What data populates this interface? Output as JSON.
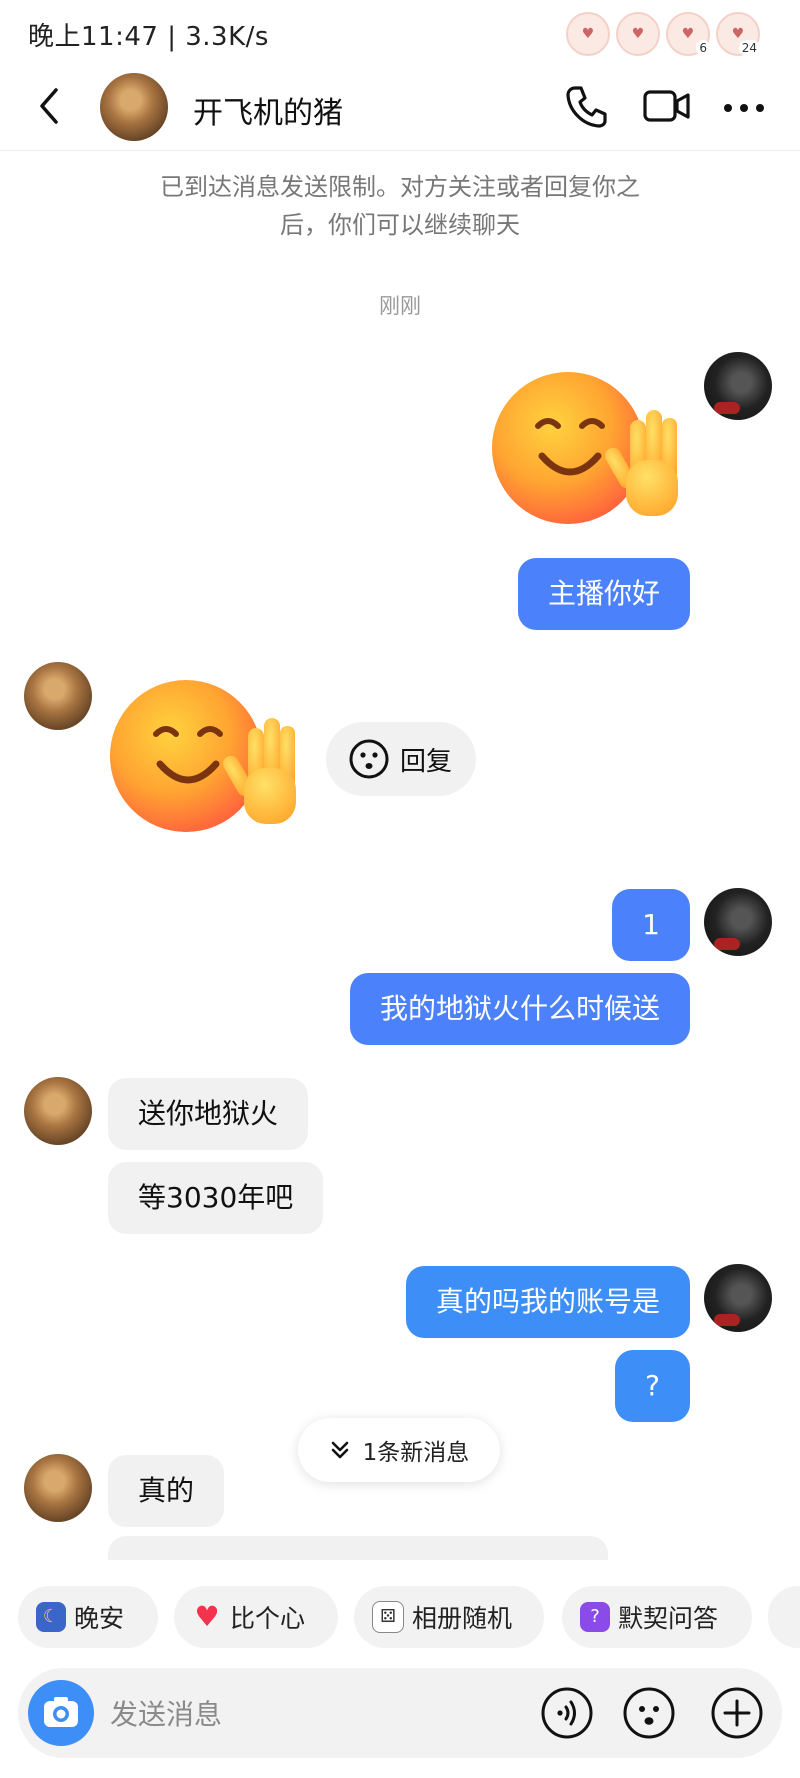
{
  "status_bar": {
    "time": "晚上11:47 | 3.3K/s",
    "badge_1": "6",
    "badge_2": "24"
  },
  "header": {
    "contact_name": "开飞机的猪"
  },
  "notice": {
    "text": "已到达消息发送限制。对方关注或者回复你之后，你们可以继续聊天"
  },
  "time_divider": "刚刚",
  "messages": [
    {
      "from": "me",
      "type": "sticker",
      "icon": "wave-smile-emoji"
    },
    {
      "from": "me",
      "type": "text",
      "text": "主播你好"
    },
    {
      "from": "other",
      "type": "sticker",
      "icon": "wave-smile-emoji"
    },
    {
      "from": "me",
      "type": "text",
      "text": "1"
    },
    {
      "from": "me",
      "type": "text",
      "text": "我的地狱火什么时候送"
    },
    {
      "from": "other",
      "type": "text",
      "text": "送你地狱火"
    },
    {
      "from": "other",
      "type": "text",
      "text": "等3030年吧"
    },
    {
      "from": "me",
      "type": "text",
      "text": "真的吗我的账号是"
    },
    {
      "from": "me",
      "type": "text",
      "text": "?"
    },
    {
      "from": "other",
      "type": "text",
      "text": "真的"
    }
  ],
  "reply_chip": {
    "label": "回复"
  },
  "new_messages": {
    "label": "1条新消息"
  },
  "quick_actions": [
    {
      "label": "晚安",
      "icon": "moon-icon"
    },
    {
      "label": "比个心",
      "icon": "heart-icon"
    },
    {
      "label": "相册随机",
      "icon": "dice-icon"
    },
    {
      "label": "默契问答",
      "icon": "question-icon"
    }
  ],
  "input": {
    "placeholder": "发送消息"
  },
  "colors": {
    "my_bubble": "#4b82fb",
    "their_bubble": "#f1f1f1",
    "accent": "#3d8ef7"
  }
}
